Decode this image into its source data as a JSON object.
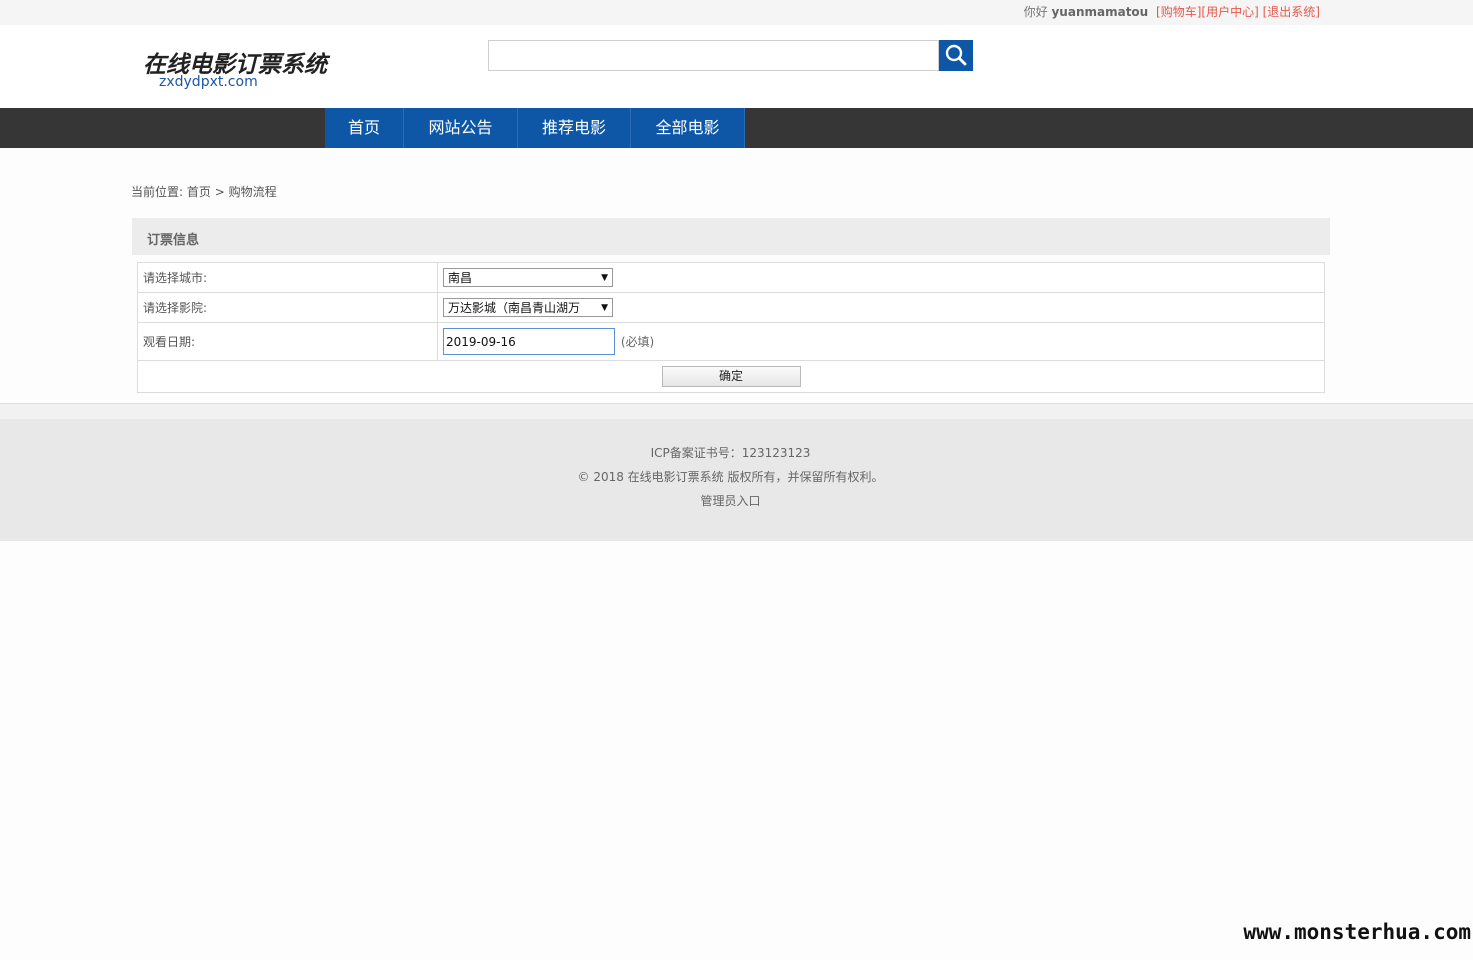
{
  "topbar": {
    "greeting": "你好",
    "username": "yuanmamatou",
    "cart_link": "[购物车]",
    "user_center_link": "[用户中心]",
    "logout_link": "[退出系统]"
  },
  "logo": {
    "cn_text": "在线电影订票系统",
    "en_text": "zxdydpxt.com"
  },
  "search": {
    "value": "",
    "icon": "search-icon"
  },
  "nav": {
    "items": [
      {
        "label": "首页"
      },
      {
        "label": "网站公告"
      },
      {
        "label": "推荐电影"
      },
      {
        "label": "全部电影"
      }
    ]
  },
  "breadcrumb": {
    "prefix": "当前位置: ",
    "home": "首页",
    "separator": " > ",
    "current": "购物流程"
  },
  "panel": {
    "title": "订票信息",
    "city_label": "请选择城市:",
    "city_value": "南昌",
    "cinema_label": "请选择影院:",
    "cinema_value": "万达影城（南昌青山湖万",
    "date_label": "观看日期:",
    "date_value": "2019-09-16",
    "required_note": "(必填)",
    "confirm_label": "确定"
  },
  "footer": {
    "icp": "ICP备案证书号：123123123",
    "copyright": "© 2018 在线电影订票系统 版权所有，并保留所有权利。",
    "admin_link": "管理员入口"
  },
  "watermark": "www.monsterhua.com",
  "colors": {
    "brand_blue": "#0d57a6",
    "nav_dark": "#363636",
    "link_red": "#e35a4f"
  }
}
